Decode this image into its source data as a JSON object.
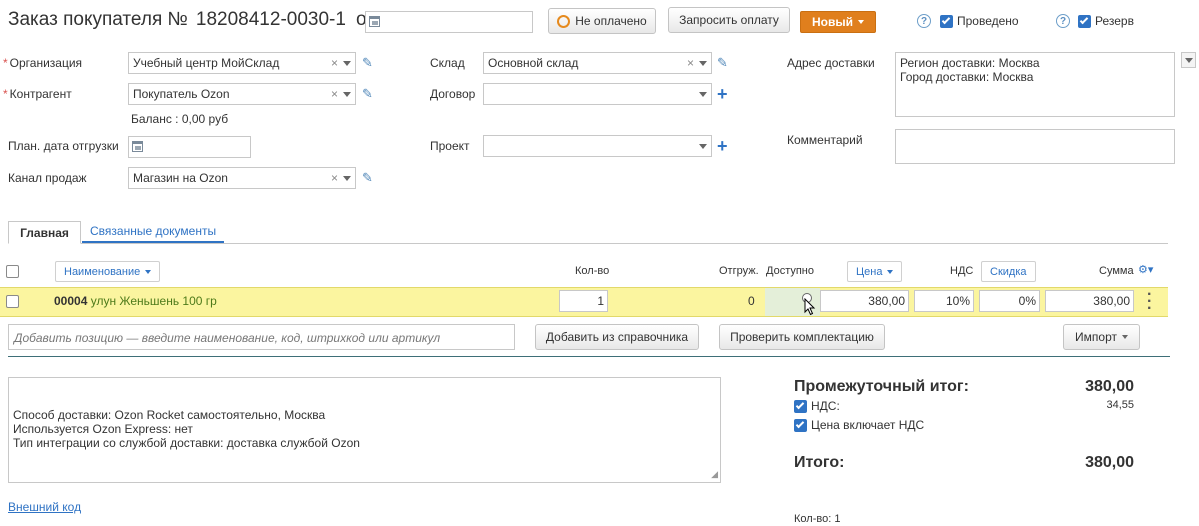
{
  "header": {
    "title": "Заказ покупателя №",
    "number": "18208412-0030-1",
    "from_label": "от",
    "date_value": "",
    "payment_status": "Не оплачено",
    "request_payment": "Запросить оплату",
    "status_button": "Новый",
    "posted_label": "Проведено",
    "reserve_label": "Резерв",
    "help_glyph": "?"
  },
  "form": {
    "organization_label": "Организация",
    "organization_value": "Учебный центр МойСклад",
    "counterparty_label": "Контрагент",
    "counterparty_value": "Покупатель Ozon",
    "balance": "Баланс : 0,00 руб",
    "ship_date_label": "План. дата отгрузки",
    "ship_date_value": "",
    "sales_channel_label": "Канал продаж",
    "sales_channel_value": "Магазин на Ozon",
    "warehouse_label": "Склад",
    "warehouse_value": "Основной склад",
    "contract_label": "Договор",
    "contract_value": "",
    "project_label": "Проект",
    "project_value": "",
    "delivery_label": "Адрес доставки",
    "delivery_line1": "Регион доставки: Москва",
    "delivery_line2": "Город доставки: Москва",
    "comment_label": "Комментарий",
    "comment_value": ""
  },
  "tabs": [
    {
      "label": "Главная",
      "active": true
    },
    {
      "label": "Связанные документы",
      "active": false
    }
  ],
  "table": {
    "headers": {
      "name": "Наименование",
      "qty": "Кол-во",
      "shipped": "Отгруж.",
      "available": "Доступно",
      "price": "Цена",
      "vat": "НДС",
      "discount": "Скидка",
      "sum": "Сумма"
    },
    "rows": [
      {
        "code": "00004",
        "name": "улун Женьшень 100 гр",
        "qty": "1",
        "shipped": "0",
        "price": "380,00",
        "vat": "10%",
        "discount": "0%",
        "sum": "380,00"
      }
    ]
  },
  "actions": {
    "add_placeholder": "Добавить позицию — введите наименование, код, штрихкод или артикул",
    "add_from_catalog": "Добавить из справочника",
    "check_kit": "Проверить комплектацию",
    "import": "Импорт"
  },
  "notes": {
    "line1": "Способ доставки: Ozon Rocket самостоятельно, Москва",
    "line2": "Используется Ozon Express: нет",
    "line3": "Тип интеграции со службой доставки: доставка службой Ozon"
  },
  "external_code_link": "Внешний код",
  "totals": {
    "subtotal_label": "Промежуточный итог:",
    "subtotal_value": "380,00",
    "vat_label": "НДС:",
    "vat_value": "34,55",
    "price_incl_vat_label": "Цена включает НДС",
    "total_label": "Итого:",
    "total_value": "380,00",
    "qty_footer": "Кол-во: 1"
  },
  "colors": {
    "accent_blue": "#2f73c4",
    "status_orange": "#e07f1d",
    "row_highlight": "#fbf59f"
  }
}
